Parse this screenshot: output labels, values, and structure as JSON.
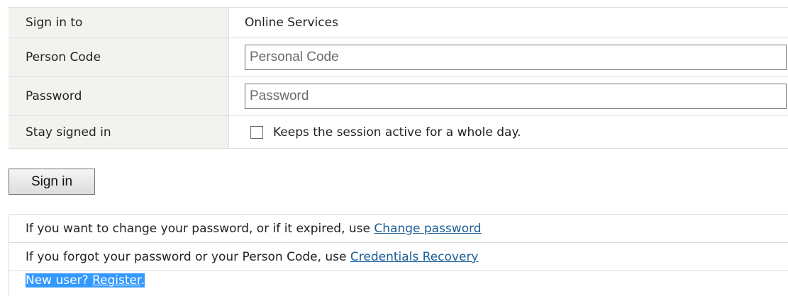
{
  "form": {
    "rows": [
      {
        "label": "Sign in to",
        "value": "Online Services"
      },
      {
        "label": "Person Code",
        "placeholder": "Personal Code",
        "value": ""
      },
      {
        "label": "Password",
        "placeholder": "Password",
        "value": ""
      },
      {
        "label": "Stay signed in",
        "checkbox_label": "Keeps the session active for a whole day.",
        "checked": false
      }
    ],
    "submit_label": "Sign in"
  },
  "help": {
    "change_password": {
      "text": "If you want to change your password, or if it expired, use ",
      "link": "Change password"
    },
    "recovery": {
      "text": "If you forgot your password or your Person Code, use ",
      "link": "Credentials Recovery"
    },
    "register": {
      "text": "New user? ",
      "link": "Register",
      "suffix": ".",
      "selected": true,
      "selection_color": "#3399ff"
    }
  },
  "colors": {
    "label_background": "#f2f2ee",
    "link": "#1a5d96",
    "border": "#dedede"
  }
}
